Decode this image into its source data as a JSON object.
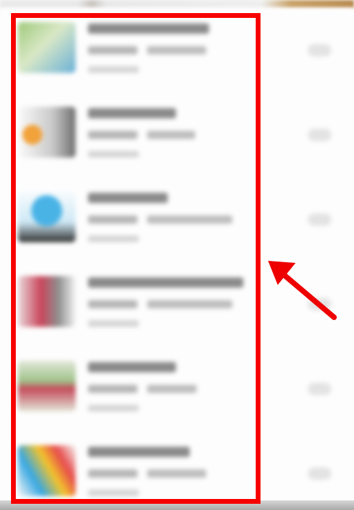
{
  "screen": {
    "description_free": true
  },
  "list": {
    "items": [
      {
        "thumbnail": "thumb-green-text",
        "thumb_colors": [
          "#9fc97a",
          "#d9e8c6",
          "#6ab0d8"
        ]
      },
      {
        "thumbnail": "thumb-orange-logo",
        "thumb_colors": [
          "#f2a23a",
          "#c9c9c9",
          "#6f6f6f"
        ]
      },
      {
        "thumbnail": "thumb-blue-badge",
        "thumb_colors": [
          "#4ab3e6",
          "#cfe9f6",
          "#2f2f2f"
        ]
      },
      {
        "thumbnail": "thumb-red-pattern",
        "thumb_colors": [
          "#c9465b",
          "#e9d9dc",
          "#8f8f8f"
        ]
      },
      {
        "thumbnail": "thumb-green-banner",
        "thumb_colors": [
          "#9fc38a",
          "#c44b5b",
          "#e2e7d9"
        ]
      },
      {
        "thumbnail": "thumb-colorful-chart",
        "thumb_colors": [
          "#e64b4b",
          "#37a7e2",
          "#f3c42c"
        ]
      }
    ]
  },
  "annotation": {
    "box_color": "#f70000",
    "arrow_color": "#ee0000"
  }
}
